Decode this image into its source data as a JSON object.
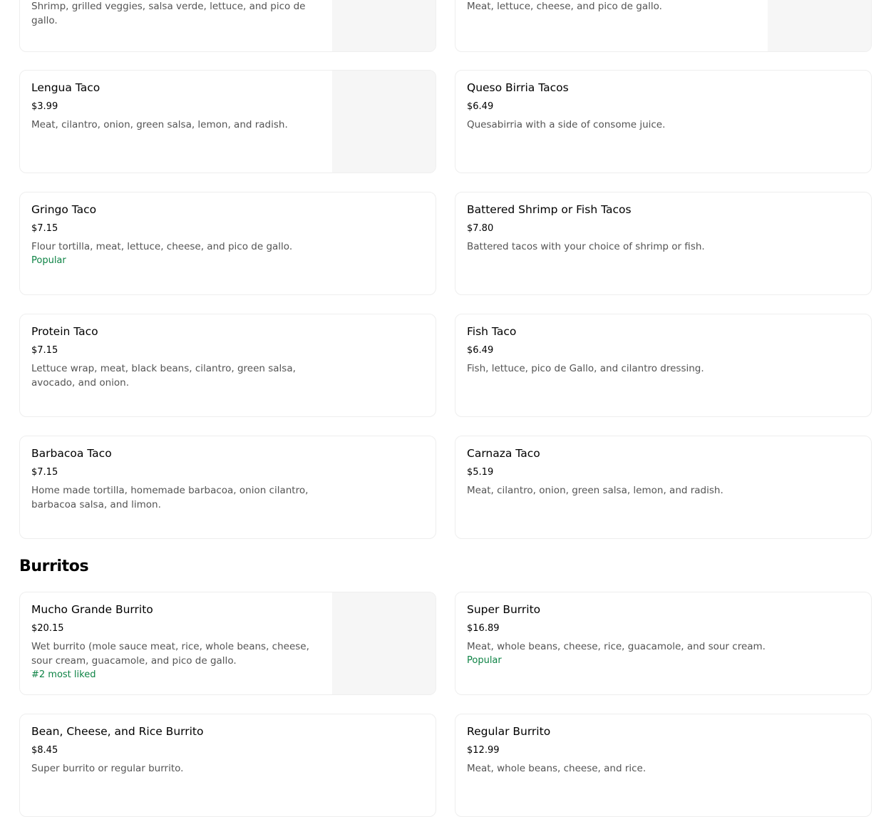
{
  "tacos": {
    "top_left": {
      "description": "Shrimp, grilled veggies, salsa verde, lettuce, and pico de gallo."
    },
    "top_right": {
      "description": "Meat, lettuce, cheese, and pico de gallo."
    },
    "items": [
      {
        "name": "Lengua Taco",
        "price": "$3.99",
        "description": "Meat, cilantro, onion, green salsa, lemon, and radish."
      },
      {
        "name": "Queso Birria Tacos",
        "price": "$6.49",
        "description": "Quesabirria with a side of consome juice."
      },
      {
        "name": "Gringo Taco",
        "price": "$7.15",
        "description": "Flour tortilla, meat, lettuce, cheese, and pico de gallo.",
        "badge": "Popular"
      },
      {
        "name": "Battered Shrimp or Fish Tacos",
        "price": "$7.80",
        "description": "Battered tacos with your choice of shrimp or fish."
      },
      {
        "name": "Protein Taco",
        "price": "$7.15",
        "description": "Lettuce wrap, meat, black beans, cilantro, green salsa, avocado, and onion."
      },
      {
        "name": "Fish Taco",
        "price": "$6.49",
        "description": "Fish, lettuce, pico de Gallo, and cilantro dressing."
      },
      {
        "name": "Barbacoa Taco",
        "price": "$7.15",
        "description": "Home made tortilla, homemade barbacoa, onion cilantro, barbacoa salsa, and limon."
      },
      {
        "name": "Carnaza Taco",
        "price": "$5.19",
        "description": "Meat, cilantro, onion, green salsa, lemon, and radish."
      }
    ]
  },
  "burritos": {
    "title": "Burritos",
    "items": [
      {
        "name": "Mucho Grande Burrito",
        "price": "$20.15",
        "description": "Wet burrito (mole sauce meat, rice, whole beans, cheese, sour cream, guacamole, and pico de gallo.",
        "badge": "#2 most liked"
      },
      {
        "name": "Super Burrito",
        "price": "$16.89",
        "description": "Meat, whole beans, cheese, rice, guacamole, and sour cream.",
        "badge": "Popular"
      },
      {
        "name": "Bean, Cheese, and Rice Burrito",
        "price": "$8.45",
        "description": "Super burrito or regular burrito."
      },
      {
        "name": "Regular Burrito",
        "price": "$12.99",
        "description": "Meat, whole beans, cheese, and rice."
      }
    ]
  },
  "colors": {
    "badge": "#0e8345",
    "placeholder": "#f6f6f6"
  }
}
